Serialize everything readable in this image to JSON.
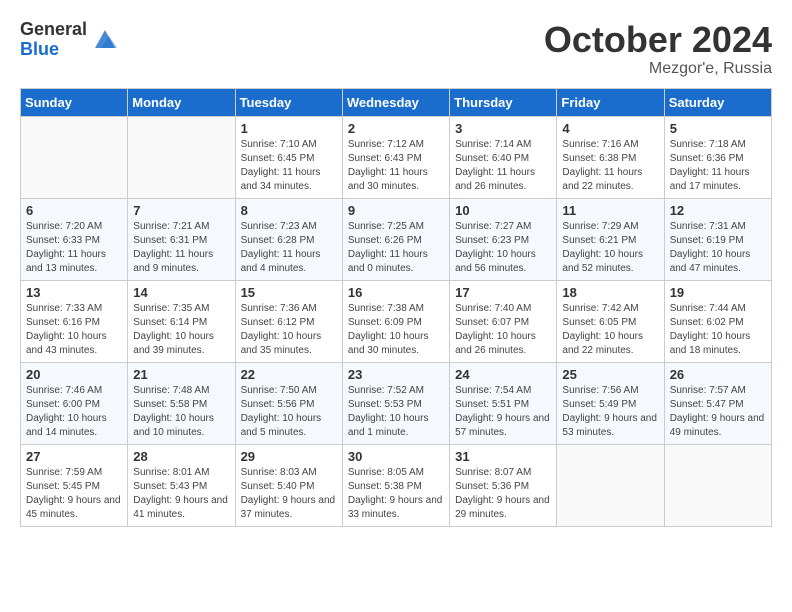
{
  "logo": {
    "general": "General",
    "blue": "Blue"
  },
  "header": {
    "month": "October 2024",
    "location": "Mezgor'e, Russia"
  },
  "weekdays": [
    "Sunday",
    "Monday",
    "Tuesday",
    "Wednesday",
    "Thursday",
    "Friday",
    "Saturday"
  ],
  "weeks": [
    [
      {
        "day": "",
        "sunrise": "",
        "sunset": "",
        "daylight": ""
      },
      {
        "day": "",
        "sunrise": "",
        "sunset": "",
        "daylight": ""
      },
      {
        "day": "1",
        "sunrise": "Sunrise: 7:10 AM",
        "sunset": "Sunset: 6:45 PM",
        "daylight": "Daylight: 11 hours and 34 minutes."
      },
      {
        "day": "2",
        "sunrise": "Sunrise: 7:12 AM",
        "sunset": "Sunset: 6:43 PM",
        "daylight": "Daylight: 11 hours and 30 minutes."
      },
      {
        "day": "3",
        "sunrise": "Sunrise: 7:14 AM",
        "sunset": "Sunset: 6:40 PM",
        "daylight": "Daylight: 11 hours and 26 minutes."
      },
      {
        "day": "4",
        "sunrise": "Sunrise: 7:16 AM",
        "sunset": "Sunset: 6:38 PM",
        "daylight": "Daylight: 11 hours and 22 minutes."
      },
      {
        "day": "5",
        "sunrise": "Sunrise: 7:18 AM",
        "sunset": "Sunset: 6:36 PM",
        "daylight": "Daylight: 11 hours and 17 minutes."
      }
    ],
    [
      {
        "day": "6",
        "sunrise": "Sunrise: 7:20 AM",
        "sunset": "Sunset: 6:33 PM",
        "daylight": "Daylight: 11 hours and 13 minutes."
      },
      {
        "day": "7",
        "sunrise": "Sunrise: 7:21 AM",
        "sunset": "Sunset: 6:31 PM",
        "daylight": "Daylight: 11 hours and 9 minutes."
      },
      {
        "day": "8",
        "sunrise": "Sunrise: 7:23 AM",
        "sunset": "Sunset: 6:28 PM",
        "daylight": "Daylight: 11 hours and 4 minutes."
      },
      {
        "day": "9",
        "sunrise": "Sunrise: 7:25 AM",
        "sunset": "Sunset: 6:26 PM",
        "daylight": "Daylight: 11 hours and 0 minutes."
      },
      {
        "day": "10",
        "sunrise": "Sunrise: 7:27 AM",
        "sunset": "Sunset: 6:23 PM",
        "daylight": "Daylight: 10 hours and 56 minutes."
      },
      {
        "day": "11",
        "sunrise": "Sunrise: 7:29 AM",
        "sunset": "Sunset: 6:21 PM",
        "daylight": "Daylight: 10 hours and 52 minutes."
      },
      {
        "day": "12",
        "sunrise": "Sunrise: 7:31 AM",
        "sunset": "Sunset: 6:19 PM",
        "daylight": "Daylight: 10 hours and 47 minutes."
      }
    ],
    [
      {
        "day": "13",
        "sunrise": "Sunrise: 7:33 AM",
        "sunset": "Sunset: 6:16 PM",
        "daylight": "Daylight: 10 hours and 43 minutes."
      },
      {
        "day": "14",
        "sunrise": "Sunrise: 7:35 AM",
        "sunset": "Sunset: 6:14 PM",
        "daylight": "Daylight: 10 hours and 39 minutes."
      },
      {
        "day": "15",
        "sunrise": "Sunrise: 7:36 AM",
        "sunset": "Sunset: 6:12 PM",
        "daylight": "Daylight: 10 hours and 35 minutes."
      },
      {
        "day": "16",
        "sunrise": "Sunrise: 7:38 AM",
        "sunset": "Sunset: 6:09 PM",
        "daylight": "Daylight: 10 hours and 30 minutes."
      },
      {
        "day": "17",
        "sunrise": "Sunrise: 7:40 AM",
        "sunset": "Sunset: 6:07 PM",
        "daylight": "Daylight: 10 hours and 26 minutes."
      },
      {
        "day": "18",
        "sunrise": "Sunrise: 7:42 AM",
        "sunset": "Sunset: 6:05 PM",
        "daylight": "Daylight: 10 hours and 22 minutes."
      },
      {
        "day": "19",
        "sunrise": "Sunrise: 7:44 AM",
        "sunset": "Sunset: 6:02 PM",
        "daylight": "Daylight: 10 hours and 18 minutes."
      }
    ],
    [
      {
        "day": "20",
        "sunrise": "Sunrise: 7:46 AM",
        "sunset": "Sunset: 6:00 PM",
        "daylight": "Daylight: 10 hours and 14 minutes."
      },
      {
        "day": "21",
        "sunrise": "Sunrise: 7:48 AM",
        "sunset": "Sunset: 5:58 PM",
        "daylight": "Daylight: 10 hours and 10 minutes."
      },
      {
        "day": "22",
        "sunrise": "Sunrise: 7:50 AM",
        "sunset": "Sunset: 5:56 PM",
        "daylight": "Daylight: 10 hours and 5 minutes."
      },
      {
        "day": "23",
        "sunrise": "Sunrise: 7:52 AM",
        "sunset": "Sunset: 5:53 PM",
        "daylight": "Daylight: 10 hours and 1 minute."
      },
      {
        "day": "24",
        "sunrise": "Sunrise: 7:54 AM",
        "sunset": "Sunset: 5:51 PM",
        "daylight": "Daylight: 9 hours and 57 minutes."
      },
      {
        "day": "25",
        "sunrise": "Sunrise: 7:56 AM",
        "sunset": "Sunset: 5:49 PM",
        "daylight": "Daylight: 9 hours and 53 minutes."
      },
      {
        "day": "26",
        "sunrise": "Sunrise: 7:57 AM",
        "sunset": "Sunset: 5:47 PM",
        "daylight": "Daylight: 9 hours and 49 minutes."
      }
    ],
    [
      {
        "day": "27",
        "sunrise": "Sunrise: 7:59 AM",
        "sunset": "Sunset: 5:45 PM",
        "daylight": "Daylight: 9 hours and 45 minutes."
      },
      {
        "day": "28",
        "sunrise": "Sunrise: 8:01 AM",
        "sunset": "Sunset: 5:43 PM",
        "daylight": "Daylight: 9 hours and 41 minutes."
      },
      {
        "day": "29",
        "sunrise": "Sunrise: 8:03 AM",
        "sunset": "Sunset: 5:40 PM",
        "daylight": "Daylight: 9 hours and 37 minutes."
      },
      {
        "day": "30",
        "sunrise": "Sunrise: 8:05 AM",
        "sunset": "Sunset: 5:38 PM",
        "daylight": "Daylight: 9 hours and 33 minutes."
      },
      {
        "day": "31",
        "sunrise": "Sunrise: 8:07 AM",
        "sunset": "Sunset: 5:36 PM",
        "daylight": "Daylight: 9 hours and 29 minutes."
      },
      {
        "day": "",
        "sunrise": "",
        "sunset": "",
        "daylight": ""
      },
      {
        "day": "",
        "sunrise": "",
        "sunset": "",
        "daylight": ""
      }
    ]
  ]
}
